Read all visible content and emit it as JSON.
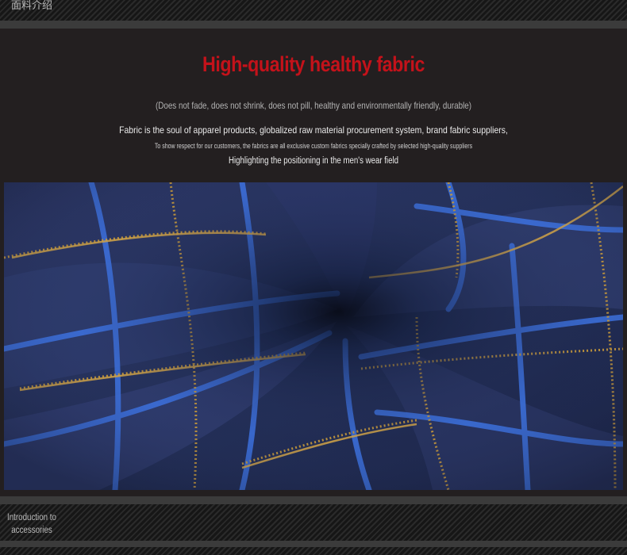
{
  "header": {
    "section_label": "面料介绍"
  },
  "fabric": {
    "headline": "High-quality healthy fabric",
    "tagline": "(Does not fade, does not shrink, does not pill, healthy and environmentally friendly, durable)",
    "line1": "Fabric is the soul of apparel products, globalized raw material procurement system, brand fabric suppliers,",
    "line2": "To show respect for our customers, the fabrics are all exclusive custom fabrics specially crafted by selected high-quality suppliers",
    "line3": "Highlighting the positioning in the men's wear field"
  },
  "footer": {
    "section_label_line1": "Introduction to",
    "section_label_line2": "accessories"
  },
  "colors": {
    "headline": "#c4121a",
    "background": "#231f20",
    "fabric_navy": "#1f2a4c",
    "fabric_blue_line": "#3a6fd8",
    "fabric_gold_line": "#c99a3a"
  },
  "icons": {
    "fabric_photo": "plaid-fabric-swirl-image"
  }
}
